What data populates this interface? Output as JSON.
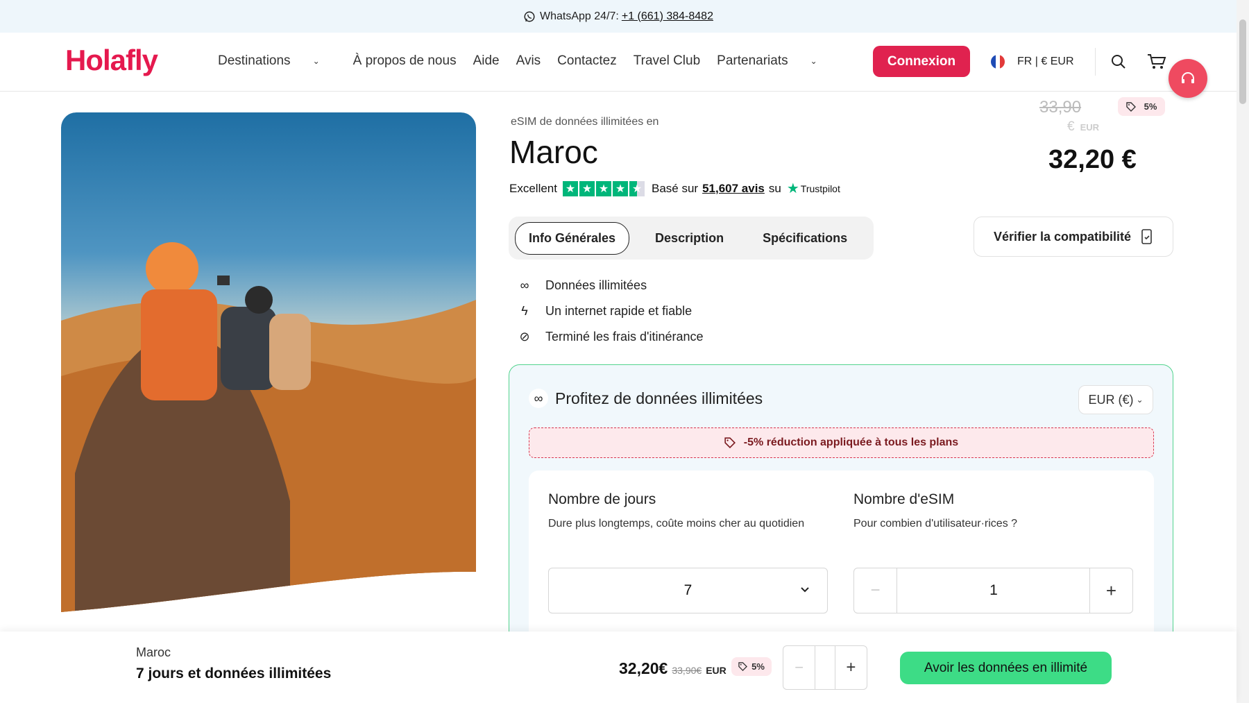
{
  "topbar": {
    "whatsapp_label": "WhatsApp 24/7:",
    "phone": "+1 (661) 384-8482"
  },
  "nav": {
    "logo": "Holafly",
    "items": [
      {
        "label": "Destinations",
        "has_dropdown": true
      },
      {
        "label": "À propos de nous"
      },
      {
        "label": "Aide"
      },
      {
        "label": "Avis"
      },
      {
        "label": "Contactez"
      },
      {
        "label": "Travel Club"
      },
      {
        "label": "Partenariats",
        "has_dropdown": true
      }
    ],
    "login_label": "Connexion",
    "locale": "FR | € EUR",
    "brand_color": "#e5194e"
  },
  "product": {
    "subtitle": "eSIM de données illimitées en",
    "title": "Maroc",
    "rating_label": "Excellent",
    "rating_stars": 4.5,
    "based_on": "Basé sur",
    "reviews": "51,607 avis",
    "on": "su",
    "trustpilot": "Trustpilot",
    "tabs": [
      "Info Générales",
      "Description",
      "Spécifications"
    ],
    "active_tab": "Info Générales",
    "compat_label": "Vérifier la compatibilité",
    "features": [
      {
        "icon": "infinity-icon",
        "label": "Données illimitées"
      },
      {
        "icon": "lightning-icon",
        "label": "Un internet rapide et fiable"
      },
      {
        "icon": "no-roaming-icon",
        "label": "Terminé les frais d'itinérance"
      }
    ],
    "old_price": "33,90",
    "old_price_currency": "€",
    "old_price_code": "EUR",
    "discount_badge": "5%",
    "price": "32,20 €"
  },
  "plan": {
    "heading": "Profitez de données illimitées",
    "currency_select": "EUR (€)",
    "discount_banner": "-5% réduction appliquée à tous les plans",
    "days": {
      "title": "Nombre de jours",
      "subtitle": "Dure plus longtemps, coûte moins cher au quotidien",
      "value": "7"
    },
    "esims": {
      "title": "Nombre d'eSIM",
      "subtitle": "Pour combien d'utilisateur·rices ?",
      "value": "1",
      "minus": "−",
      "plus": "+"
    }
  },
  "bottom_bar": {
    "country": "Maroc",
    "plan": "7 jours et données illimitées",
    "price": "32,20€",
    "old_price": "33,90€",
    "currency": "EUR",
    "badge": "5%",
    "qty": "",
    "minus": "−",
    "plus": "+",
    "cta": "Avoir les données en illimité",
    "cta_color": "#3ddc86"
  }
}
